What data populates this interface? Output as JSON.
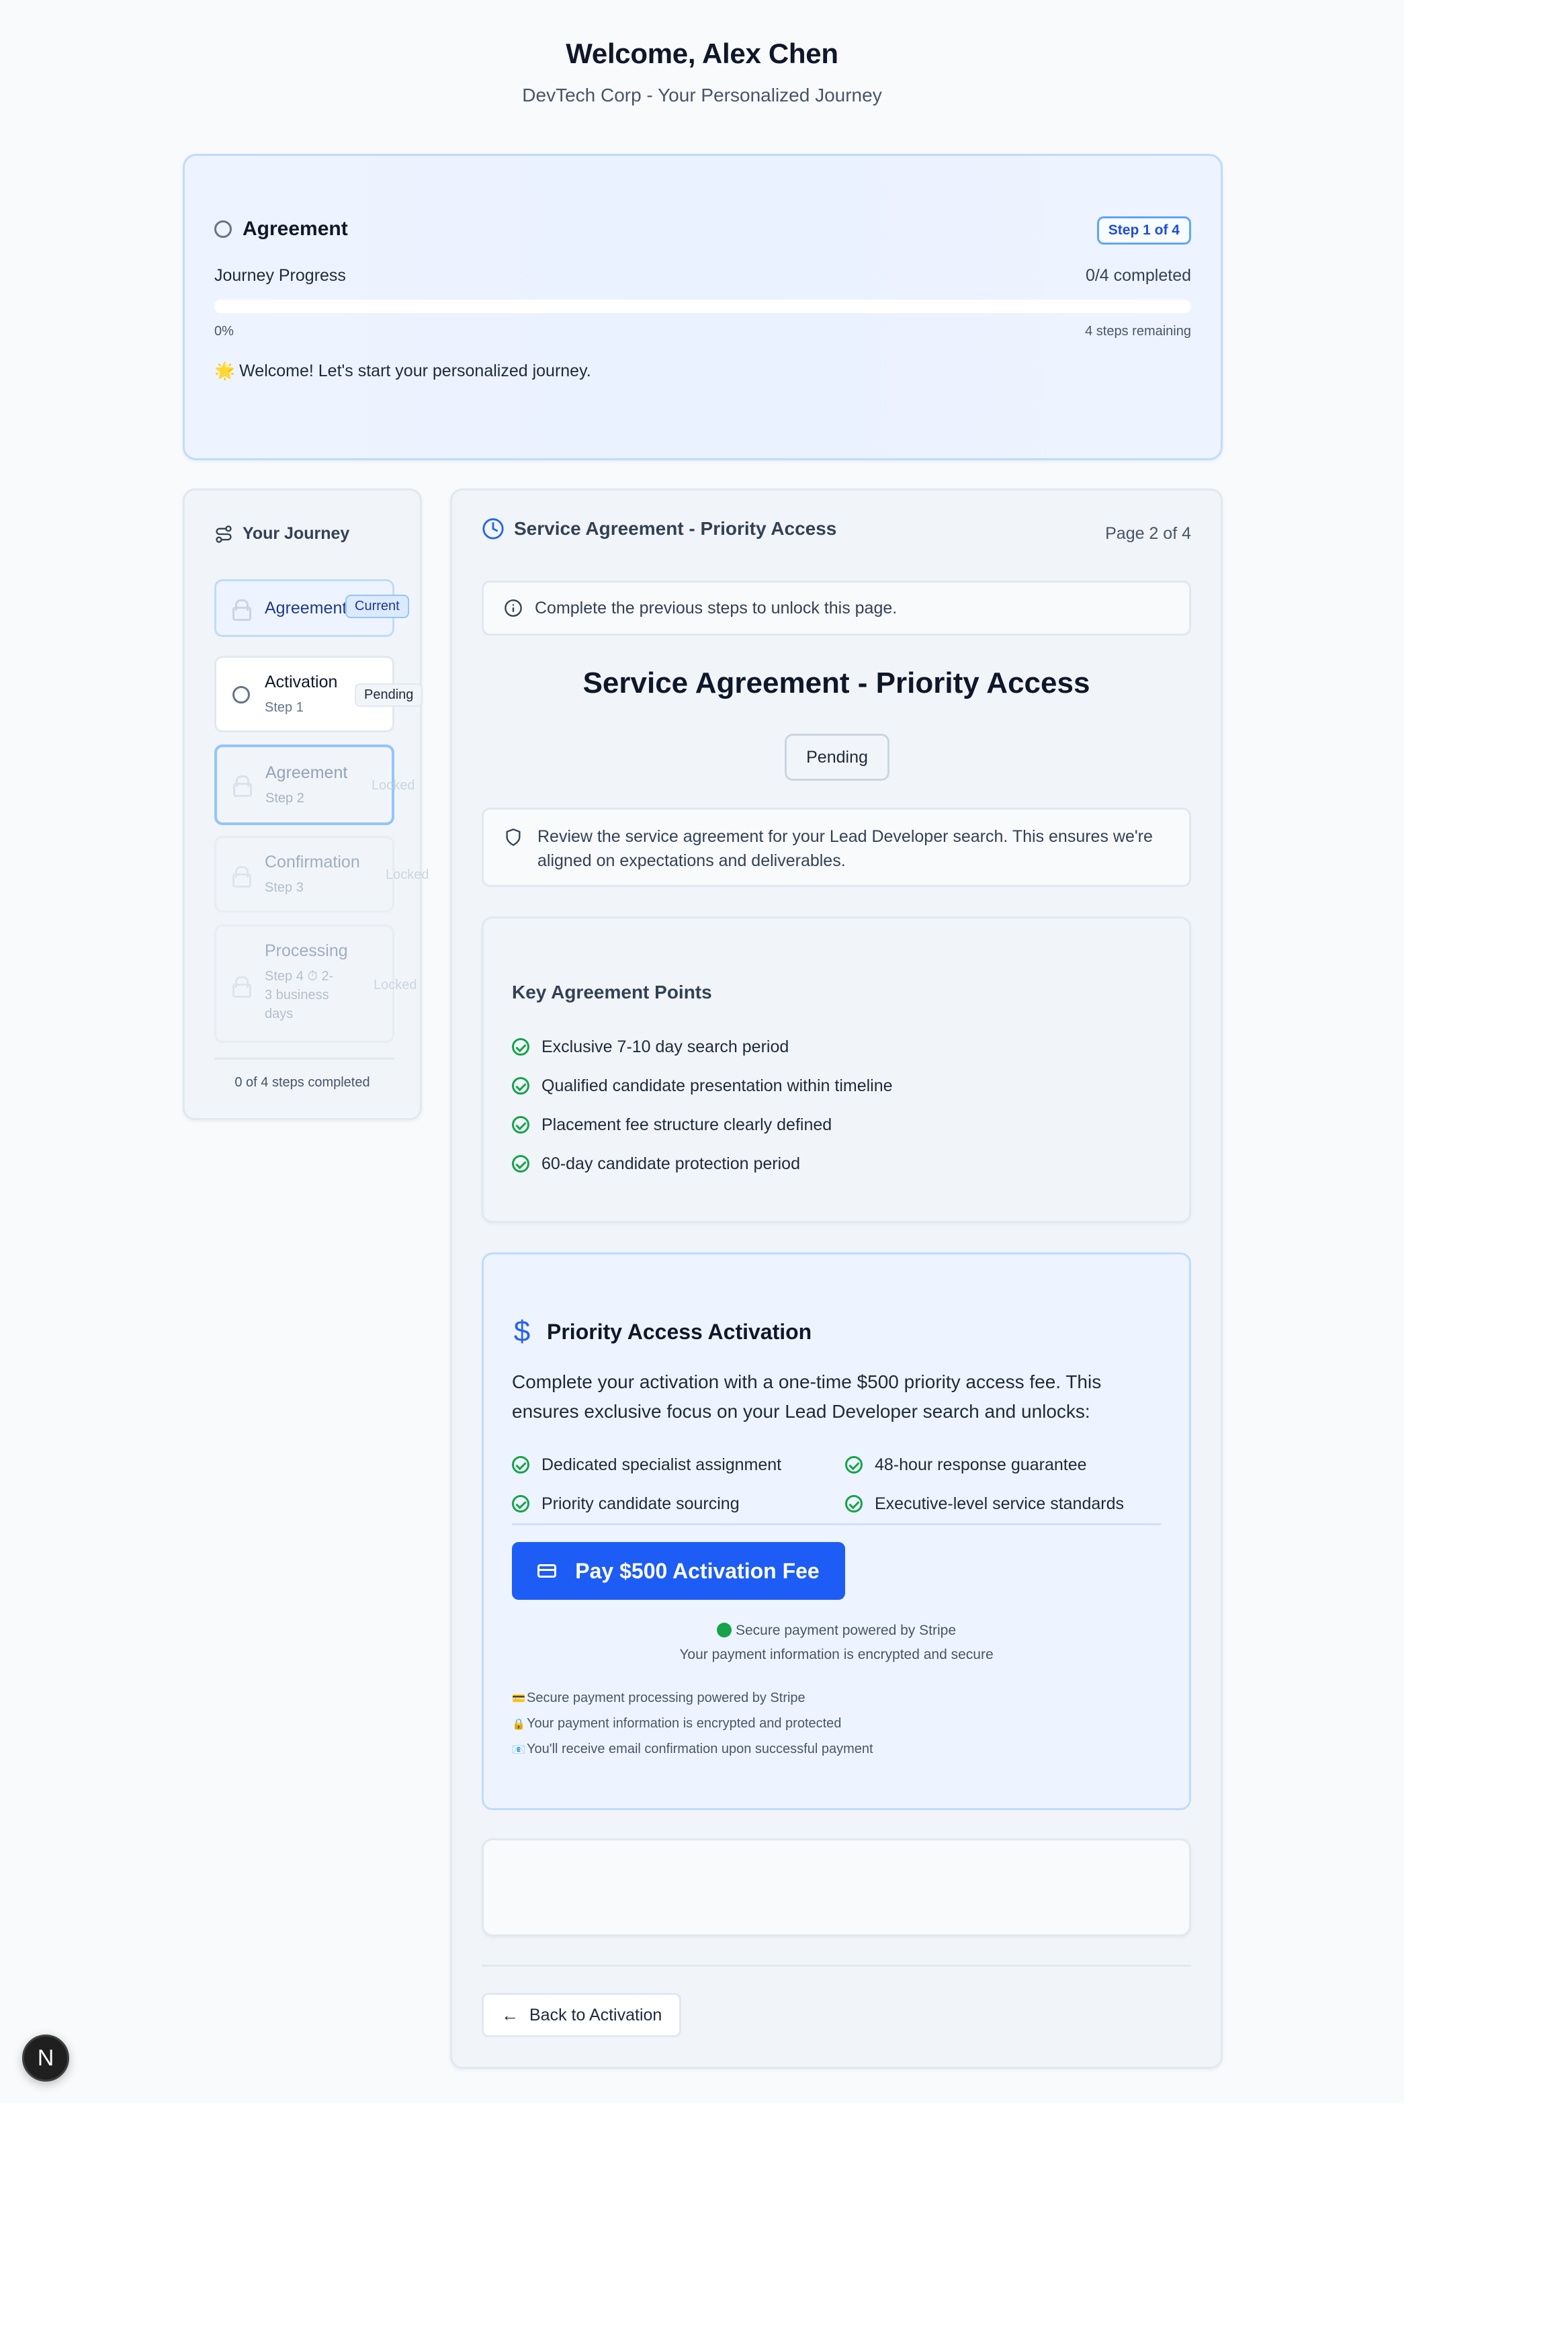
{
  "header": {
    "title": "Welcome, Alex Chen",
    "subtitle": "DevTech Corp - Your Personalized Journey"
  },
  "progress": {
    "step_title": "Agreement",
    "step_badge": "Step 1 of 4",
    "label": "Journey Progress",
    "completed": "0/4 completed",
    "percent_label": "0%",
    "percent_value": 0,
    "remaining": "4 steps remaining",
    "message_icon": "🌟",
    "message": "Welcome! Let's start your personalized journey."
  },
  "sidebar": {
    "title": "Your Journey",
    "items": [
      {
        "label": "Agreement",
        "sub": "",
        "badge": "Current",
        "state": "current",
        "icon": "lock-icon"
      },
      {
        "label": "Activation",
        "sub": "Step 1",
        "badge": "Pending",
        "state": "pending",
        "icon": "circle-icon"
      },
      {
        "label": "Agreement",
        "sub": "Step 2",
        "badge": "Locked",
        "state": "locked-selected",
        "icon": "lock-icon"
      },
      {
        "label": "Confirmation",
        "sub": "Step 3",
        "badge": "Locked",
        "state": "locked",
        "icon": "lock-icon"
      },
      {
        "label": "Processing",
        "sub_line1": "Step 4  ⏱ 2-",
        "sub_line2": "3 business",
        "sub_line3": "days",
        "badge": "Locked",
        "state": "locked",
        "icon": "lock-icon"
      }
    ],
    "footer": "0 of 4 steps completed"
  },
  "main": {
    "header_title": "Service Agreement - Priority Access",
    "page_label": "Page 2 of 4",
    "notice": "Complete the previous steps to unlock this page.",
    "title": "Service Agreement - Priority Access",
    "status_button": "Pending",
    "review_text": "Review the service agreement for your Lead Developer search. This ensures we're aligned on expectations and deliverables.",
    "key_points": {
      "title": "Key Agreement Points",
      "items": [
        "Exclusive 7-10 day search period",
        "Qualified candidate presentation within timeline",
        "Placement fee structure clearly defined",
        "60-day candidate protection period"
      ]
    },
    "activation": {
      "icon": "$",
      "title": "Priority Access Activation",
      "description": "Complete your activation with a one-time $500 priority access fee. This ensures exclusive focus on your Lead Developer search and unlocks:",
      "benefits": [
        "Dedicated specialist assignment",
        "48-hour response guarantee",
        "Priority candidate sourcing",
        "Executive-level service standards"
      ],
      "pay_button": "Pay $500 Activation Fee",
      "secure_line1": "Secure payment powered by Stripe",
      "secure_line2": "Your payment information is encrypted and secure",
      "notes": [
        {
          "icon": "💳",
          "text": "Secure payment processing powered by Stripe"
        },
        {
          "icon": "🔒",
          "text": "Your payment information is encrypted and protected"
        },
        {
          "icon": "📧",
          "text": "You'll receive email confirmation upon successful payment"
        }
      ]
    },
    "back_button": "Back to Activation"
  },
  "fab": {
    "label": "N"
  },
  "colors": {
    "accent": "#2563eb",
    "pay_button": "#1d5cf5",
    "success": "#16a34a",
    "page_bg": "#f8fafc"
  }
}
